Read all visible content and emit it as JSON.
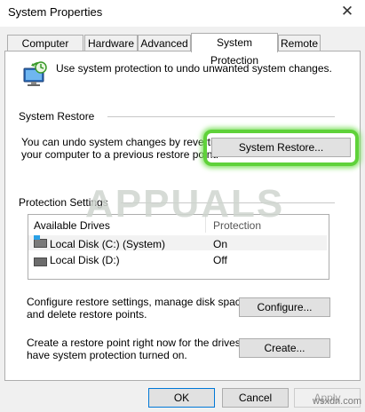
{
  "window": {
    "title": "System Properties",
    "close_glyph": "✕"
  },
  "tabs": [
    {
      "label": "Computer Name",
      "active": false
    },
    {
      "label": "Hardware",
      "active": false
    },
    {
      "label": "Advanced",
      "active": false
    },
    {
      "label": "System Protection",
      "active": true
    },
    {
      "label": "Remote",
      "active": false
    }
  ],
  "intro": {
    "text": "Use system protection to undo unwanted system changes.",
    "icon": "computer-restore-icon"
  },
  "system_restore": {
    "group_label": "System Restore",
    "description_line1": "You can undo system changes by reverting",
    "description_line2": "your computer to a previous restore point.",
    "button_label": "System Restore...",
    "highlight_color": "#5fd23a"
  },
  "protection": {
    "group_label": "Protection Settings",
    "columns": [
      "Available Drives",
      "Protection"
    ],
    "drives": [
      {
        "name": "Local Disk (C:) (System)",
        "protection": "On",
        "icon": "system-drive-icon"
      },
      {
        "name": "Local Disk (D:)",
        "protection": "Off",
        "icon": "drive-icon"
      }
    ]
  },
  "configure": {
    "text_line1": "Configure restore settings, manage disk space,",
    "text_line2": "and delete restore points.",
    "button_label": "Configure..."
  },
  "create": {
    "text_line1": "Create a restore point right now for the drives that",
    "text_line2": "have system protection turned on.",
    "button_label": "Create..."
  },
  "footer": {
    "ok_label": "OK",
    "cancel_label": "Cancel",
    "apply_label": "Apply"
  },
  "watermark": {
    "brand": "APPUALS",
    "site": "wsxdn.com"
  }
}
